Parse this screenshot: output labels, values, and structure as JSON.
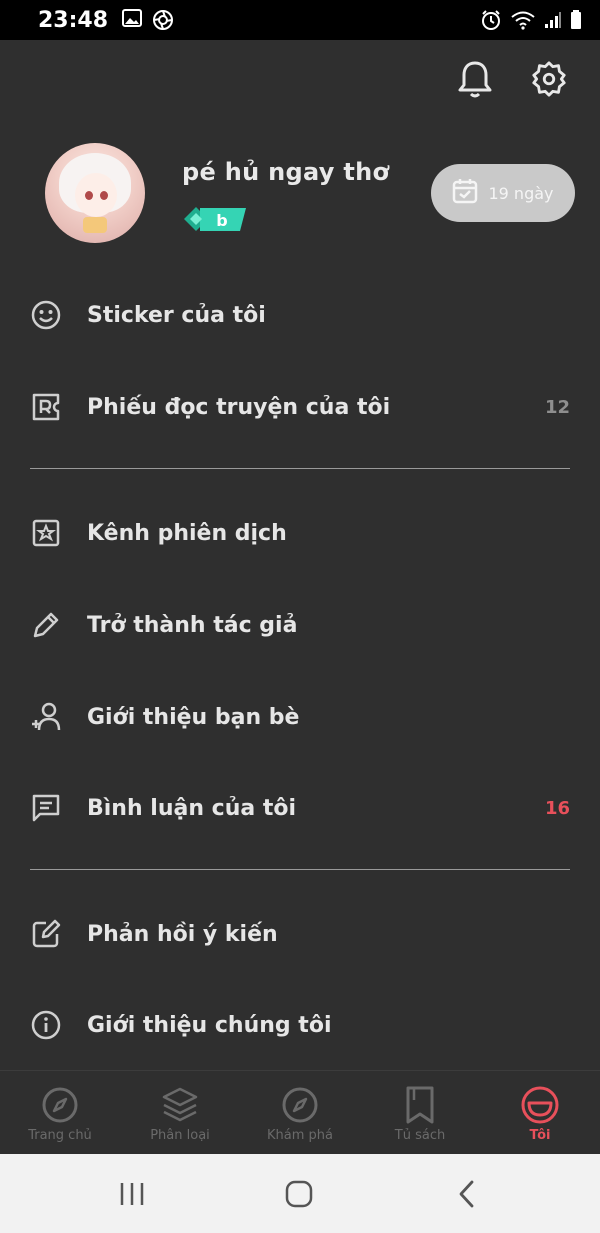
{
  "status_bar": {
    "time": "23:48",
    "left_icons": [
      "image-icon",
      "camera-shutter-icon"
    ],
    "right_icons": [
      "alarm-icon",
      "wifi-icon",
      "signal-icon",
      "battery-icon"
    ]
  },
  "header": {
    "icons": [
      "bell-icon",
      "settings-icon"
    ]
  },
  "profile": {
    "username": "pé hủ ngay thơ",
    "badge_letter": "b",
    "checkin_label": "19 ngày"
  },
  "menu": {
    "items": [
      {
        "icon": "smiley-icon",
        "label": "Sticker của tôi",
        "count": ""
      },
      {
        "icon": "ticket-r-icon",
        "label": "Phiếu đọc truyện của tôi",
        "count": "12"
      },
      {
        "icon": "translator-channel-icon",
        "label": "Kênh phiên dịch",
        "count": ""
      },
      {
        "icon": "pencil-icon",
        "label": "Trở thành tác giả",
        "count": ""
      },
      {
        "icon": "add-user-icon",
        "label": "Giới thiệu bạn bè",
        "count": ""
      },
      {
        "icon": "comment-icon",
        "label": "Bình luận của tôi",
        "count": "16"
      },
      {
        "icon": "edit-icon",
        "label": "Phản hồi ý kiến",
        "count": ""
      },
      {
        "icon": "info-icon",
        "label": "Giới thiệu chúng tôi",
        "count": ""
      }
    ]
  },
  "colors": {
    "background": "#2f2f2f",
    "accent": "#e8505b",
    "muted_count": "#8e8e8e",
    "badge": "#2fd0b0"
  },
  "bottom_nav": {
    "items": [
      {
        "icon": "compass-icon",
        "label": "Trang chủ",
        "active": false
      },
      {
        "icon": "layers-icon",
        "label": "Phân loại",
        "active": false
      },
      {
        "icon": "compass-icon",
        "label": "Khám phá",
        "active": false
      },
      {
        "icon": "bookmark-icon",
        "label": "Tủ sách",
        "active": false
      },
      {
        "icon": "profile-icon",
        "label": "Tôi",
        "active": true
      }
    ]
  },
  "system_nav": {
    "icons": [
      "recent-apps-icon",
      "home-icon",
      "back-icon"
    ]
  }
}
